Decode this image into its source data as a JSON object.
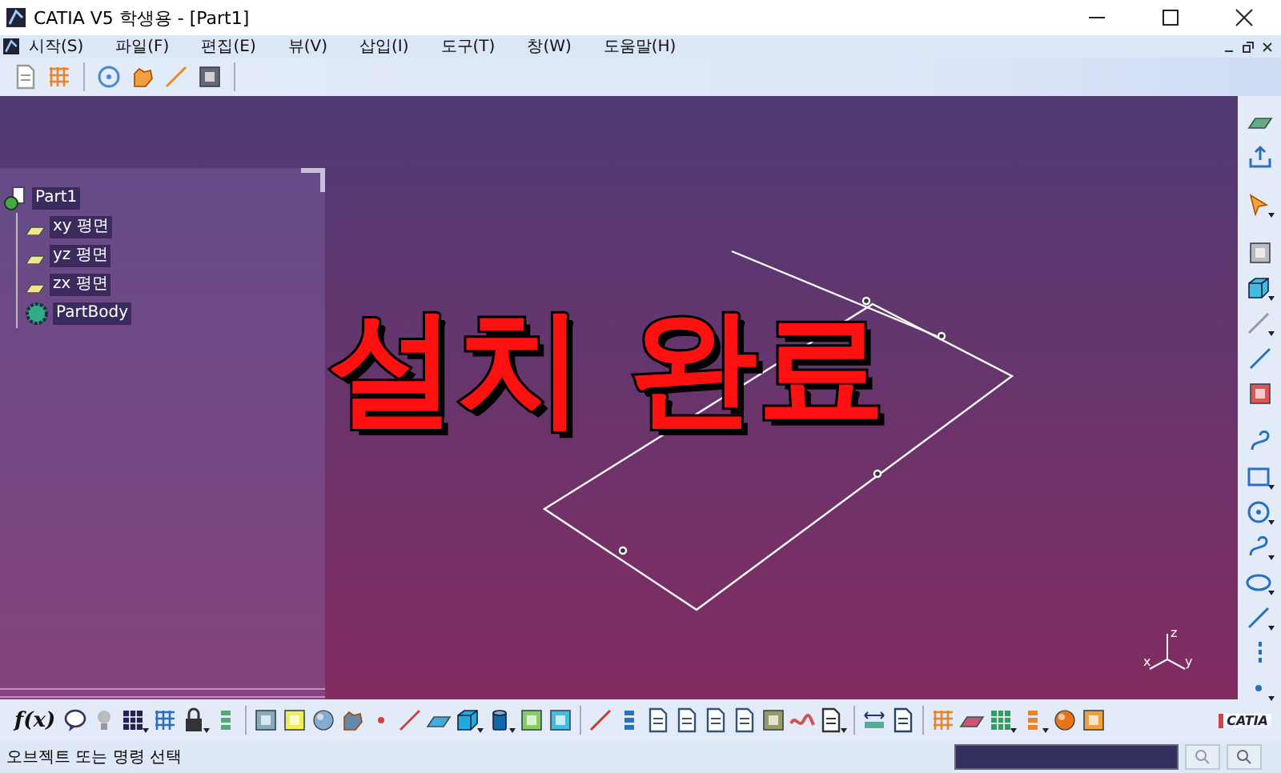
{
  "window": {
    "title": "CATIA V5 학생용 - [Part1]"
  },
  "menu": [
    "시작(S)",
    "파일(F)",
    "편집(E)",
    "뷰(V)",
    "삽입(I)",
    "도구(T)",
    "창(W)",
    "도움말(H)"
  ],
  "tree": {
    "label": "Part1",
    "children": [
      {
        "label": "xy 평면",
        "kind": "plane"
      },
      {
        "label": "yz 평면",
        "kind": "plane"
      },
      {
        "label": "zx 평면",
        "kind": "plane"
      },
      {
        "label": "PartBody",
        "kind": "body"
      }
    ]
  },
  "overlay_caption": "설치 완료",
  "axis_labels": [
    "z",
    "x",
    "y"
  ],
  "bottom_toolbar": {
    "formula_button": "f(x)"
  },
  "logo": {
    "text": "CATIA"
  },
  "status_bar": {
    "message": "오브젝트 또는 명령 선택"
  }
}
